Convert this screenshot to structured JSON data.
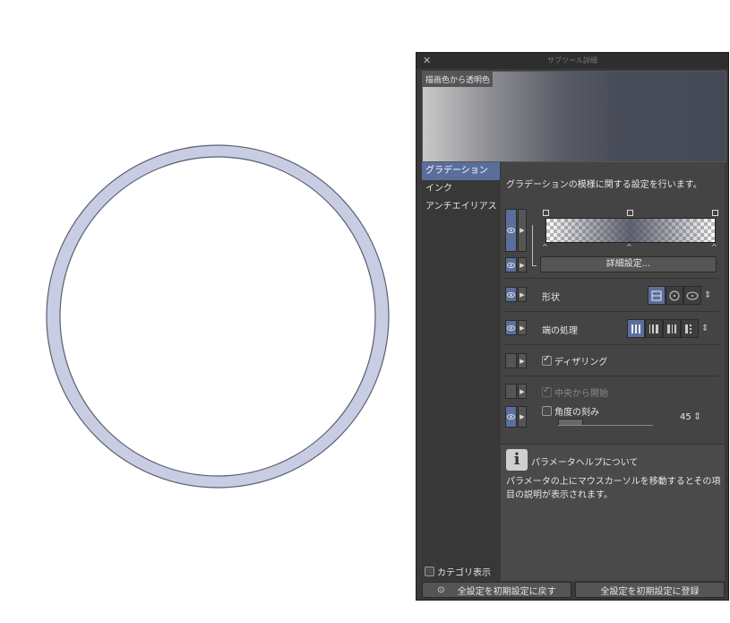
{
  "panel": {
    "title": "サブツール詳細",
    "close_icon": "close-icon",
    "preview_label": "描画色から透明色",
    "categories": [
      {
        "label": "グラデーション",
        "active": true
      },
      {
        "label": "インク",
        "active": false
      },
      {
        "label": "アンチエイリアス",
        "active": false
      }
    ],
    "category_toggle_label": "カテゴリ表示",
    "description": "グラデーションの模様に関する設定を行います。",
    "detail_button": "詳細設定...",
    "shape_label": "形状",
    "edge_label": "端の処理",
    "dithering_label": "ディザリング",
    "dithering_checked": true,
    "center_start_label": "中央から開始",
    "center_start_checked": true,
    "center_start_enabled": false,
    "angle_step_label": "角度の刻み",
    "angle_step_checked": false,
    "angle_value": "45",
    "help_title": "パラメータヘルプについて",
    "help_body": "パラメータの上にマウスカーソルを移動するとその項目の説明が表示されます。",
    "reset_button": "全設定を初期設定に戻す",
    "register_button": "全設定を初期設定に登録"
  },
  "colors": {
    "accent": "#5b6f9d",
    "ring_fill": "#c8cde3",
    "ring_stroke": "#5a5f70"
  }
}
